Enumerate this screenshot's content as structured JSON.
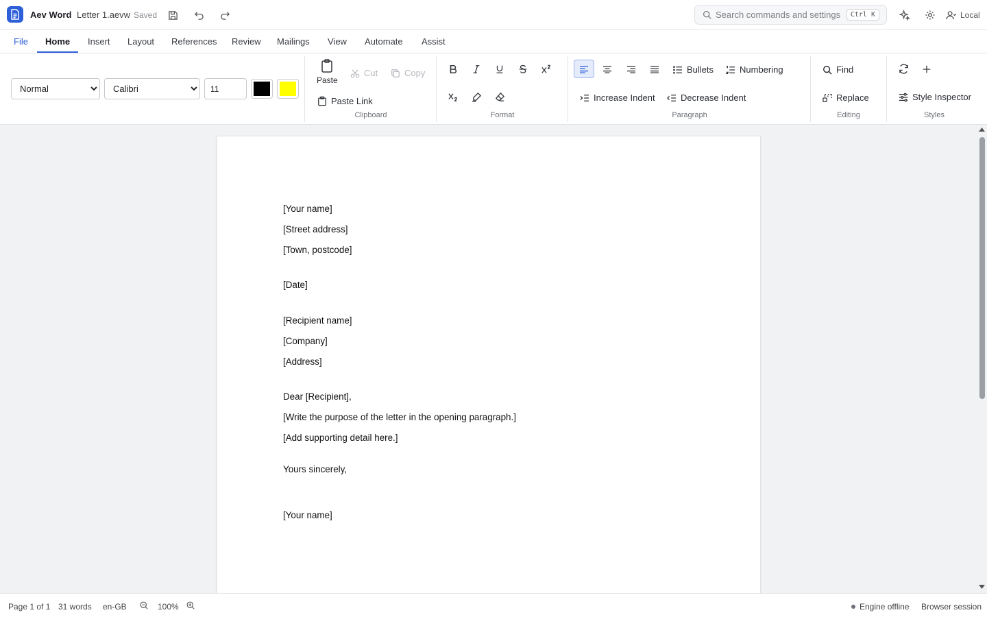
{
  "app": {
    "name": "Aev Word",
    "doc_name": "Letter 1.aevw",
    "save_state": "Saved"
  },
  "search": {
    "placeholder": "Search commands and settings",
    "shortcut": "Ctrl K"
  },
  "account": {
    "label": "Local"
  },
  "tabs": [
    {
      "label": "File"
    },
    {
      "label": "Home"
    },
    {
      "label": "Insert"
    },
    {
      "label": "Layout"
    },
    {
      "label": "References"
    },
    {
      "label": "Review"
    },
    {
      "label": "Mailings"
    },
    {
      "label": "View"
    },
    {
      "label": "Automate"
    },
    {
      "label": "Assist"
    }
  ],
  "active_tab": "Home",
  "ribbon": {
    "style_value": "Normal",
    "font_value": "Calibri",
    "font_size": "11",
    "text_color": "#000000",
    "highlight_color": "#ffff00",
    "clipboard": {
      "paste": "Paste",
      "cut": "Cut",
      "copy": "Copy",
      "paste_link": "Paste Link",
      "label": "Clipboard"
    },
    "format": {
      "label": "Format"
    },
    "paragraph": {
      "bullets": "Bullets",
      "numbering": "Numbering",
      "increase_indent": "Increase Indent",
      "decrease_indent": "Decrease Indent",
      "label": "Paragraph"
    },
    "editing": {
      "find": "Find",
      "replace": "Replace",
      "label": "Editing"
    },
    "styles": {
      "inspector": "Style Inspector",
      "label": "Styles"
    }
  },
  "document": {
    "lines": [
      "[Your name]",
      "[Street address]",
      "[Town, postcode]",
      "[Date]",
      "[Recipient name]",
      "[Company]",
      "[Address]",
      "Dear [Recipient],",
      "[Write the purpose of the letter in the opening paragraph.]",
      "[Add supporting detail here.]",
      "Yours sincerely,",
      "[Your name]"
    ]
  },
  "status": {
    "page": "Page 1 of 1",
    "words": "31 words",
    "language": "en-GB",
    "zoom": "100%",
    "engine": "Engine offline",
    "session": "Browser session"
  },
  "colors": {
    "accent": "#2d5fd9"
  }
}
